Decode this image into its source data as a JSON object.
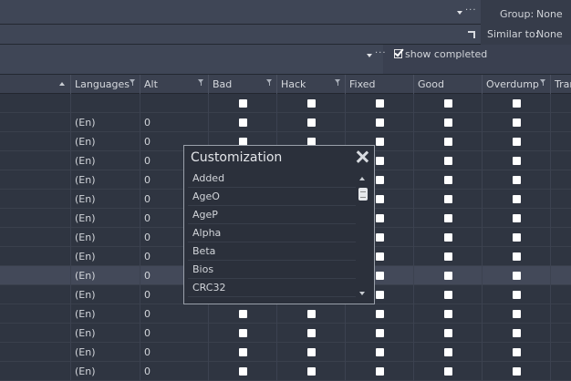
{
  "toolbar": {
    "group_label": "Group:",
    "group_value": "None",
    "similar_label": "Similar to:",
    "similar_value": "None",
    "show_completed_label": "show completed"
  },
  "table": {
    "headers": [
      "Languages",
      "Alt",
      "Bad",
      "Hack",
      "Fixed",
      "Good",
      "Overdump",
      "Tran"
    ],
    "rows": [
      {
        "languages": "",
        "alt": ""
      },
      {
        "languages": "(En)",
        "alt": "0"
      },
      {
        "languages": "(En)",
        "alt": "0"
      },
      {
        "languages": "(En)",
        "alt": "0"
      },
      {
        "languages": "(En)",
        "alt": "0"
      },
      {
        "languages": "(En)",
        "alt": "0"
      },
      {
        "languages": "(En)",
        "alt": "0"
      },
      {
        "languages": "(En)",
        "alt": "0"
      },
      {
        "languages": "(En)",
        "alt": "0"
      },
      {
        "languages": "(En)",
        "alt": "0"
      },
      {
        "languages": "(En)",
        "alt": "0"
      },
      {
        "languages": "(En)",
        "alt": "0"
      },
      {
        "languages": "(En)",
        "alt": "0"
      },
      {
        "languages": "(En)",
        "alt": "0"
      },
      {
        "languages": "(En)",
        "alt": "0"
      }
    ]
  },
  "popup": {
    "title": "Customization",
    "items": [
      "Added",
      "AgeO",
      "AgeP",
      "Alpha",
      "Beta",
      "Bios",
      "CRC32"
    ]
  },
  "colors": {
    "background": "#2e3440",
    "header": "#3b4150",
    "selected_row": "#434959",
    "popup_border": "#9aa0aa"
  }
}
